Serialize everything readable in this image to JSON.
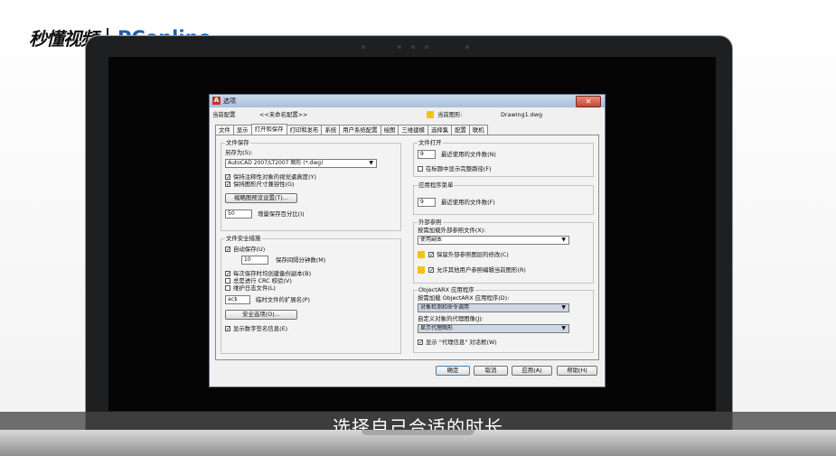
{
  "watermark": {
    "brand_left": "秒懂视频",
    "brand_right": "PConline"
  },
  "subtitle": "选择自己合适的时长",
  "dialog": {
    "title": "选项",
    "profile_label": "当前配置",
    "profile_value": "<<未命名配置>>",
    "drawing_label": "当前图形:",
    "drawing_value": "Drawing1.dwg",
    "tabs": [
      "文件",
      "显示",
      "打开和保存",
      "打印和发布",
      "系统",
      "用户系统配置",
      "绘图",
      "三维建模",
      "选择集",
      "配置",
      "联机"
    ],
    "file_save": {
      "group": "文件保存",
      "saveas_label": "另存为(S):",
      "saveas_value": "AutoCAD 2007/LT2007 图形 (*.dwg)",
      "cb_annot": "保持注释性对象的视觉逼真度(Y)",
      "cb_size": "保持图形尺寸兼容性(G)",
      "thumb_button": "缩略图预览设置(T)...",
      "incr_value": "50",
      "incr_label": "增量保存百分比(I)"
    },
    "file_safety": {
      "group": "文件安全措施",
      "autosave": "自动保存(U)",
      "minutes_value": "10",
      "minutes_label": "保存间隔分钟数(M)",
      "cb_backup": "每次保存时均创建备份副本(B)",
      "cb_crc": "总是进行 CRC 校验(V)",
      "cb_log": "维护日志文件(L)",
      "ext_value": "ac$",
      "ext_label": "临时文件的扩展名(P)",
      "security_button": "安全选项(O)...",
      "cb_signature": "显示数字签名信息(E)"
    },
    "file_open": {
      "group": "文件打开",
      "recent_value": "9",
      "recent_label": "最近使用的文件数(N)",
      "cb_fullpath": "在标题中显示完整路径(F)"
    },
    "app_menu": {
      "group": "应用程序菜单",
      "recent_value": "9",
      "recent_label": "最近使用的文件数(F)"
    },
    "xref": {
      "group": "外部参照",
      "demand_label": "按需加载外部参照文件(X):",
      "demand_value": "使用副本",
      "cb_keep": "保留外部参照图层的修改(C)",
      "cb_allow": "允许其他用户参照编辑当前图形(R)"
    },
    "arx": {
      "group": "ObjectARX 应用程序",
      "load_label": "按需加载 ObjectARX 应用程序(D):",
      "load_value": "对象检测和命令调用",
      "proxy_label": "自定义对象的代理图像(J):",
      "proxy_value": "显示代理图形",
      "cb_proxy": "显示 \"代理信息\" 对话框(W)"
    },
    "buttons": {
      "ok": "确定",
      "cancel": "取消",
      "apply": "应用(A)",
      "help": "帮助(H)"
    }
  }
}
